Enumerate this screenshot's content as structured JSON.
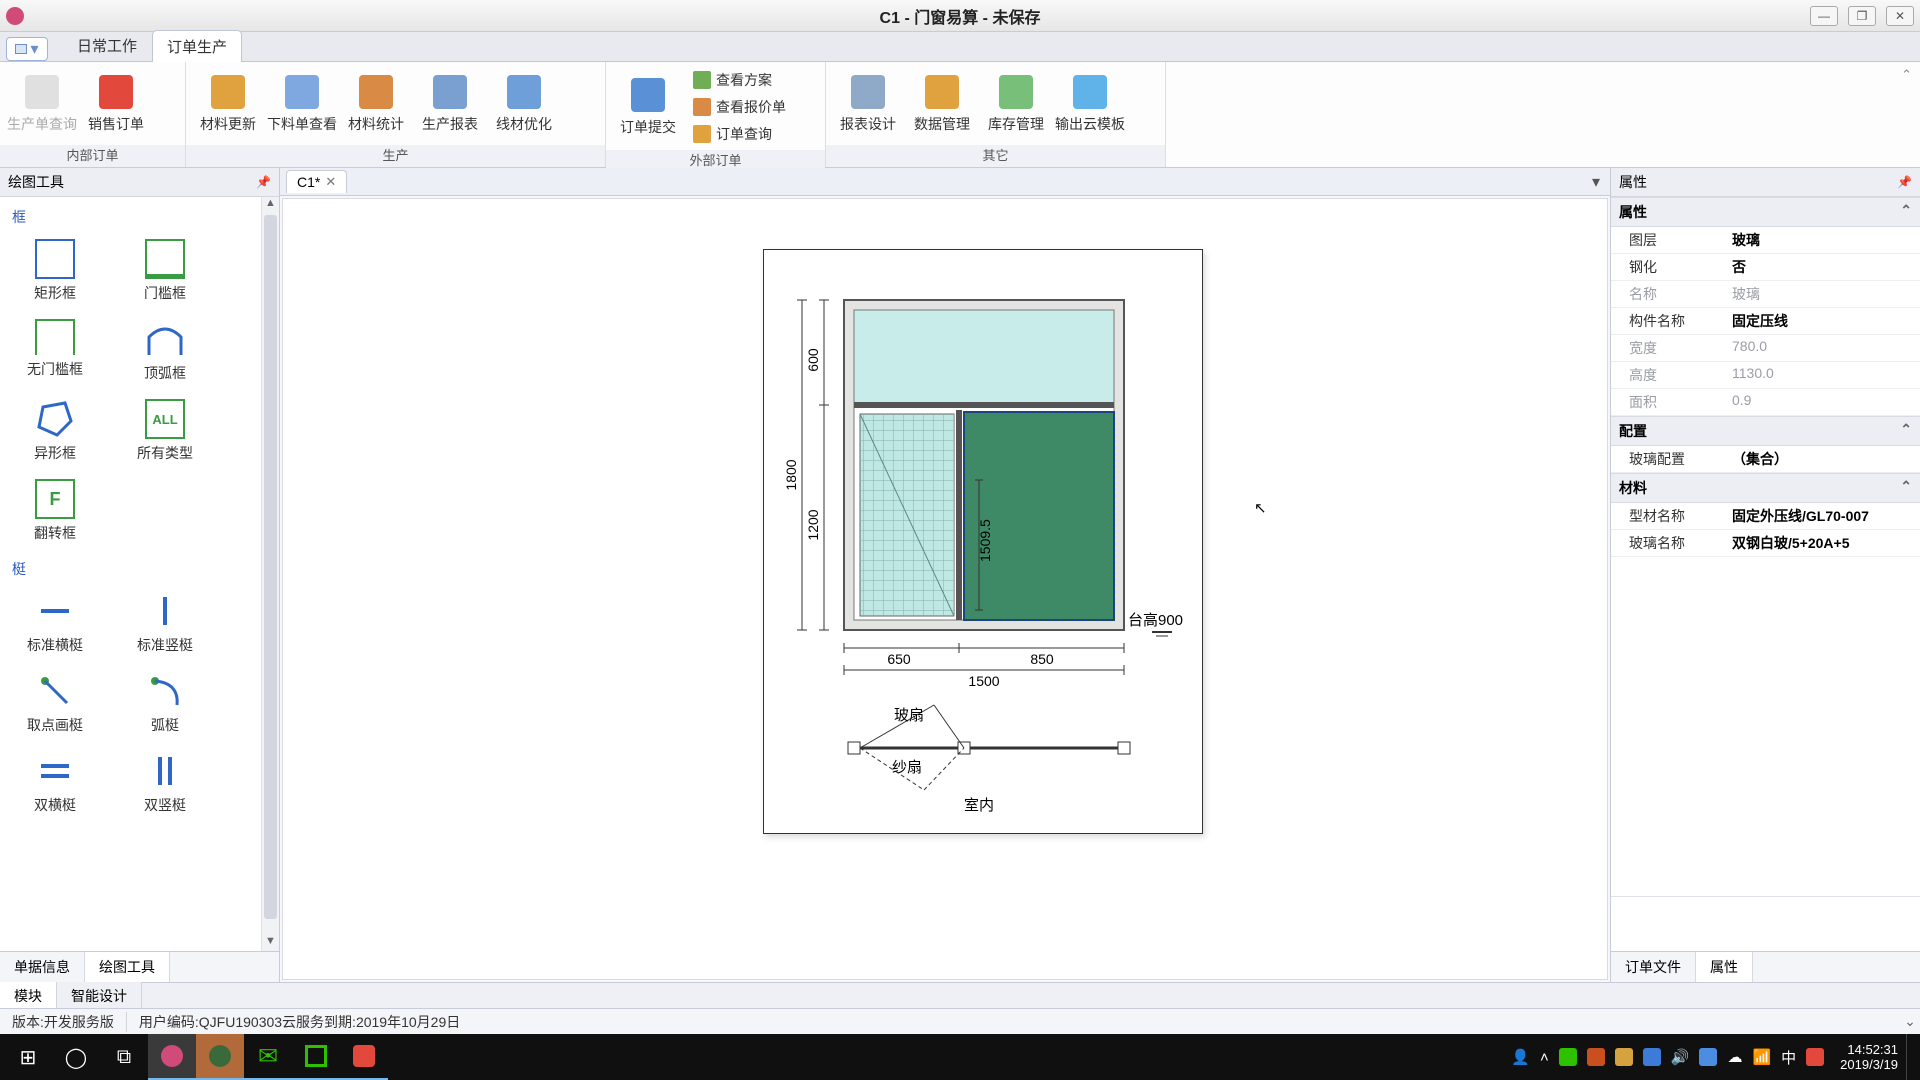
{
  "title": "C1 - 门窗易算 - 未保存",
  "menutabs": {
    "t1": "日常工作",
    "t2": "订单生产"
  },
  "ribbon": {
    "g1": {
      "b1": "生产单查询",
      "b2": "销售订单",
      "label": "内部订单"
    },
    "g2": {
      "b1": "材料更新",
      "b2": "下料单查看",
      "b3": "材料统计",
      "b4": "生产报表",
      "b5": "线材优化",
      "label": "生产"
    },
    "g3": {
      "b1": "订单提交",
      "s1": "查看方案",
      "s2": "查看报价单",
      "s3": "订单查询",
      "label": "外部订单"
    },
    "g4": {
      "b1": "报表设计",
      "b2": "数据管理",
      "b3": "库存管理",
      "b4": "输出云模板",
      "label": "其它"
    }
  },
  "left": {
    "title": "绘图工具",
    "sec1": "框",
    "t1": "矩形框",
    "t2": "门槛框",
    "t3": "无门槛框",
    "t4": "顶弧框",
    "t5": "异形框",
    "t6": "所有类型",
    "t7": "翻转框",
    "sec2": "梃",
    "t8": "标准横梃",
    "t9": "标准竖梃",
    "t10": "取点画梃",
    "t11": "弧梃",
    "t12": "双横梃",
    "t13": "双竖梃",
    "bt1": "单据信息",
    "bt2": "绘图工具"
  },
  "doc": {
    "tab": "C1*"
  },
  "drawing": {
    "h1": "600",
    "h2": "1200",
    "htotal": "1800",
    "w1": "650",
    "w2": "850",
    "wtotal": "1500",
    "inner": "1509.5",
    "sill": "台高900",
    "leg1": "玻扇",
    "leg2": "纱扇",
    "room": "室内"
  },
  "right": {
    "title": "属性",
    "grp1": "属性",
    "r1k": "图层",
    "r1v": "玻璃",
    "r2k": "钢化",
    "r2v": "否",
    "r3k": "名称",
    "r3v": "玻璃",
    "r4k": "构件名称",
    "r4v": "固定压线",
    "r5k": "宽度",
    "r5v": "780.0",
    "r6k": "高度",
    "r6v": "1130.0",
    "r7k": "面积",
    "r7v": "0.9",
    "grp2": "配置",
    "r8k": "玻璃配置",
    "r8v": "（集合）",
    "grp3": "材料",
    "r9k": "型材名称",
    "r9v": "固定外压线/GL70-007",
    "r10k": "玻璃名称",
    "r10v": "双钢白玻/5+20A+5",
    "bt1": "订单文件",
    "bt2": "属性"
  },
  "mod": {
    "t1": "模块",
    "t2": "智能设计"
  },
  "status": {
    "s1": "版本:开发服务版",
    "s2": "用户编码:QJFU190303云服务到期:2019年10月29日"
  },
  "taskbar": {
    "time": "14:52:31",
    "date": "2019/3/19",
    "ime": "中"
  }
}
